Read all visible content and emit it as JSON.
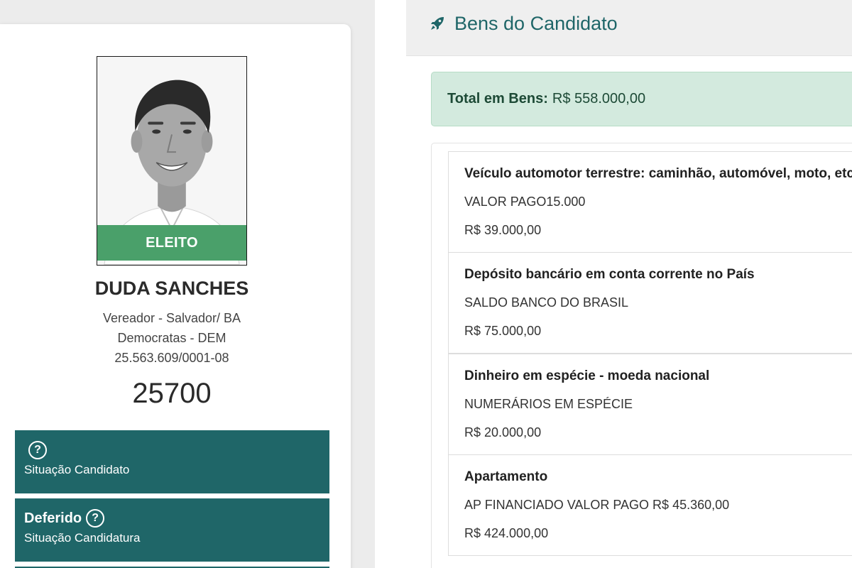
{
  "candidate": {
    "status": "ELEITO",
    "name": "DUDA SANCHES",
    "office": "Vereador - Salvador/ BA",
    "party": "Democratas - DEM",
    "cnpj": "25.563.609/0001-08",
    "number": "25700"
  },
  "info_boxes": [
    {
      "value": "",
      "label": "Situação Candidato",
      "icon": "help-circle-icon"
    },
    {
      "value": "Deferido",
      "label": "Situação Candidatura",
      "icon": "help-circle-icon"
    }
  ],
  "assets_panel": {
    "title": "Bens do Candidato",
    "icon": "rocket-icon",
    "total_label": "Total em Bens:",
    "total_value": "R$ 558.000,00",
    "items": [
      {
        "title": "Veículo automotor terrestre: caminhão, automóvel, moto, etc.",
        "description": "VALOR PAGO15.000",
        "value": "R$ 39.000,00"
      },
      {
        "title": "Depósito bancário em conta corrente no País",
        "description": "SALDO BANCO DO BRASIL",
        "value": "R$ 75.000,00"
      },
      {
        "title": "Dinheiro em espécie - moeda nacional",
        "description": "NUMERÁRIOS EM ESPÉCIE",
        "value": "R$ 20.000,00"
      },
      {
        "title": "Apartamento",
        "description": "AP FINANCIADO VALOR PAGO R$ 45.360,00",
        "value": "R$ 424.000,00"
      }
    ]
  },
  "colors": {
    "teal": "#1f6668",
    "elected_green": "#4aa06a",
    "alert_bg": "#d3eade"
  }
}
